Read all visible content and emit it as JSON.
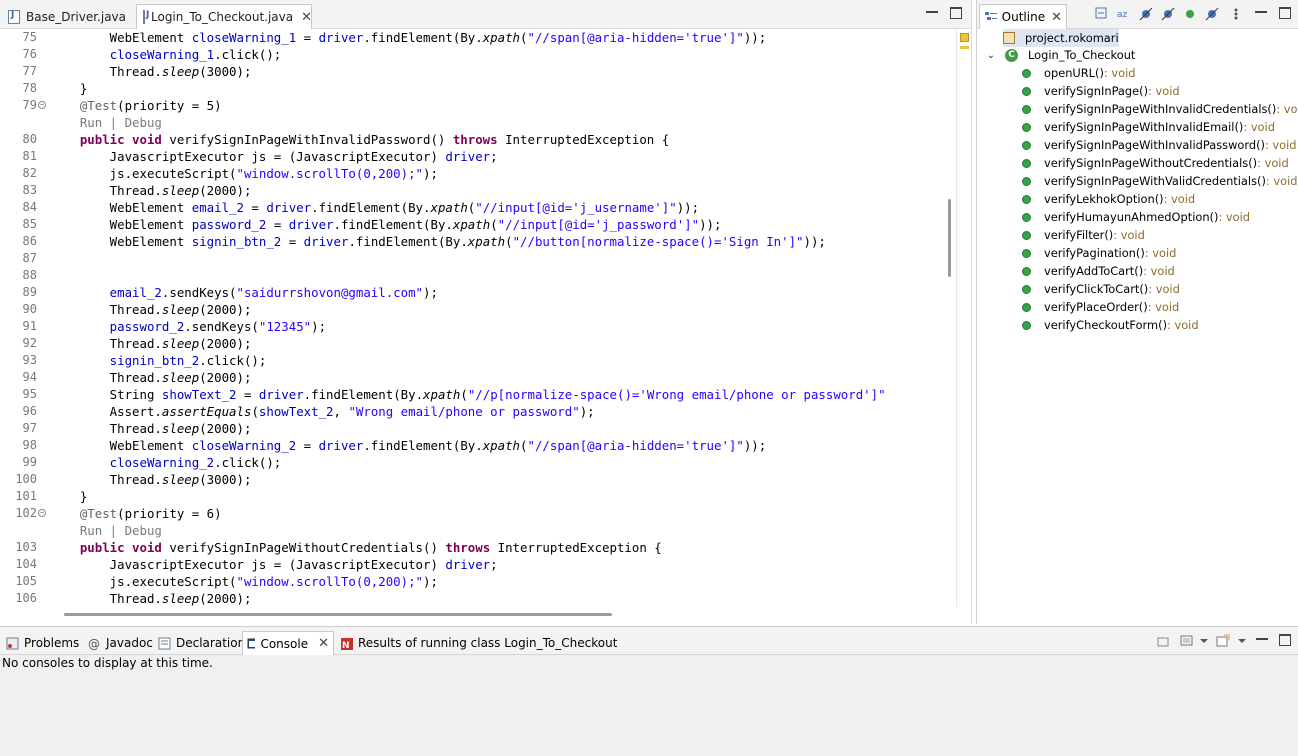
{
  "editor": {
    "tabs": [
      {
        "label": "Base_Driver.java",
        "active": false
      },
      {
        "label": "Login_To_Checkout.java",
        "active": true
      }
    ],
    "close_glyph": "✕",
    "lines": [
      {
        "n": "75",
        "tokens": [
          [
            "",
            "        WebElement "
          ],
          [
            "fld",
            "closeWarning_1"
          ],
          [
            "",
            " = "
          ],
          [
            "fld",
            "driver"
          ],
          [
            "",
            ".findElement(By."
          ],
          [
            "it",
            "xpath"
          ],
          [
            "",
            "("
          ],
          [
            "str",
            "\"//span[@aria-hidden='true']\""
          ],
          [
            "",
            "));"
          ]
        ]
      },
      {
        "n": "76",
        "tokens": [
          [
            "",
            "        "
          ],
          [
            "fld",
            "closeWarning_1"
          ],
          [
            "",
            ".click();"
          ]
        ]
      },
      {
        "n": "77",
        "tokens": [
          [
            "",
            "        Thread."
          ],
          [
            "it",
            "sleep"
          ],
          [
            "",
            "(3000);"
          ]
        ]
      },
      {
        "n": "78",
        "tokens": [
          [
            "",
            "    }"
          ]
        ]
      },
      {
        "n": "79",
        "fold": true,
        "tokens": [
          [
            "ann",
            "    @Test"
          ],
          [
            "",
            "(priority = 5)"
          ]
        ]
      },
      {
        "n": "",
        "tokens": [
          [
            "lnk",
            "    Run | Debug"
          ]
        ]
      },
      {
        "n": "80",
        "tokens": [
          [
            "kw",
            "    public void"
          ],
          [
            "",
            " verifySignInPageWithInvalidPassword() "
          ],
          [
            "kw",
            "throws"
          ],
          [
            "",
            " InterruptedException {"
          ]
        ]
      },
      {
        "n": "81",
        "tokens": [
          [
            "",
            "        JavascriptExecutor js = (JavascriptExecutor) "
          ],
          [
            "fld",
            "driver"
          ],
          [
            "",
            ";"
          ]
        ]
      },
      {
        "n": "82",
        "tokens": [
          [
            "",
            "        js.executeScript("
          ],
          [
            "str",
            "\"window.scrollTo(0,200);\""
          ],
          [
            "",
            ");"
          ]
        ]
      },
      {
        "n": "83",
        "tokens": [
          [
            "",
            "        Thread."
          ],
          [
            "it",
            "sleep"
          ],
          [
            "",
            "(2000);"
          ]
        ]
      },
      {
        "n": "84",
        "tokens": [
          [
            "",
            "        WebElement "
          ],
          [
            "fld",
            "email_2"
          ],
          [
            "",
            " = "
          ],
          [
            "fld",
            "driver"
          ],
          [
            "",
            ".findElement(By."
          ],
          [
            "it",
            "xpath"
          ],
          [
            "",
            "("
          ],
          [
            "str",
            "\"//input[@id='j_username']\""
          ],
          [
            "",
            "));"
          ]
        ]
      },
      {
        "n": "85",
        "tokens": [
          [
            "",
            "        WebElement "
          ],
          [
            "fld",
            "password_2"
          ],
          [
            "",
            " = "
          ],
          [
            "fld",
            "driver"
          ],
          [
            "",
            ".findElement(By."
          ],
          [
            "it",
            "xpath"
          ],
          [
            "",
            "("
          ],
          [
            "str",
            "\"//input[@id='j_password']\""
          ],
          [
            "",
            "));"
          ]
        ]
      },
      {
        "n": "86",
        "tokens": [
          [
            "",
            "        WebElement "
          ],
          [
            "fld",
            "signin_btn_2"
          ],
          [
            "",
            " = "
          ],
          [
            "fld",
            "driver"
          ],
          [
            "",
            ".findElement(By."
          ],
          [
            "it",
            "xpath"
          ],
          [
            "",
            "("
          ],
          [
            "str",
            "\"//button[normalize-space()='Sign In']\""
          ],
          [
            "",
            "));"
          ]
        ]
      },
      {
        "n": "87",
        "tokens": []
      },
      {
        "n": "88",
        "tokens": []
      },
      {
        "n": "89",
        "tokens": [
          [
            "fld",
            "        email_2"
          ],
          [
            "",
            ".sendKeys("
          ],
          [
            "str",
            "\"saidurrshovon@gmail.com\""
          ],
          [
            "",
            ");"
          ]
        ]
      },
      {
        "n": "90",
        "tokens": [
          [
            "",
            "        Thread."
          ],
          [
            "it",
            "sleep"
          ],
          [
            "",
            "(2000);"
          ]
        ]
      },
      {
        "n": "91",
        "tokens": [
          [
            "fld",
            "        password_2"
          ],
          [
            "",
            ".sendKeys("
          ],
          [
            "str",
            "\"12345\""
          ],
          [
            "",
            ");"
          ]
        ]
      },
      {
        "n": "92",
        "tokens": [
          [
            "",
            "        Thread."
          ],
          [
            "it",
            "sleep"
          ],
          [
            "",
            "(2000);"
          ]
        ]
      },
      {
        "n": "93",
        "tokens": [
          [
            "fld",
            "        signin_btn_2"
          ],
          [
            "",
            ".click();"
          ]
        ]
      },
      {
        "n": "94",
        "tokens": [
          [
            "",
            "        Thread."
          ],
          [
            "it",
            "sleep"
          ],
          [
            "",
            "(2000);"
          ]
        ]
      },
      {
        "n": "95",
        "tokens": [
          [
            "",
            "        String "
          ],
          [
            "fld",
            "showText_2"
          ],
          [
            "",
            " = "
          ],
          [
            "fld",
            "driver"
          ],
          [
            "",
            ".findElement(By."
          ],
          [
            "it",
            "xpath"
          ],
          [
            "",
            "("
          ],
          [
            "str",
            "\"//p[normalize-space()='Wrong email/phone or password']\""
          ]
        ]
      },
      {
        "n": "96",
        "tokens": [
          [
            "",
            "        Assert."
          ],
          [
            "it",
            "assertEquals"
          ],
          [
            "",
            "("
          ],
          [
            "fld",
            "showText_2"
          ],
          [
            "",
            ", "
          ],
          [
            "str",
            "\"Wrong email/phone or password\""
          ],
          [
            "",
            ");"
          ]
        ]
      },
      {
        "n": "97",
        "tokens": [
          [
            "",
            "        Thread."
          ],
          [
            "it",
            "sleep"
          ],
          [
            "",
            "(2000);"
          ]
        ]
      },
      {
        "n": "98",
        "tokens": [
          [
            "",
            "        WebElement "
          ],
          [
            "fld",
            "closeWarning_2"
          ],
          [
            "",
            " = "
          ],
          [
            "fld",
            "driver"
          ],
          [
            "",
            ".findElement(By."
          ],
          [
            "it",
            "xpath"
          ],
          [
            "",
            "("
          ],
          [
            "str",
            "\"//span[@aria-hidden='true']\""
          ],
          [
            "",
            "));"
          ]
        ]
      },
      {
        "n": "99",
        "tokens": [
          [
            "fld",
            "        closeWarning_2"
          ],
          [
            "",
            ".click();"
          ]
        ]
      },
      {
        "n": "100",
        "tokens": [
          [
            "",
            "        Thread."
          ],
          [
            "it",
            "sleep"
          ],
          [
            "",
            "(3000);"
          ]
        ]
      },
      {
        "n": "101",
        "tokens": [
          [
            "",
            "    }"
          ]
        ]
      },
      {
        "n": "102",
        "fold": true,
        "tokens": [
          [
            "ann",
            "    @Test"
          ],
          [
            "",
            "(priority = 6)"
          ]
        ]
      },
      {
        "n": "",
        "tokens": [
          [
            "lnk",
            "    Run | Debug"
          ]
        ]
      },
      {
        "n": "103",
        "tokens": [
          [
            "kw",
            "    public void"
          ],
          [
            "",
            " verifySignInPageWithoutCredentials() "
          ],
          [
            "kw",
            "throws"
          ],
          [
            "",
            " InterruptedException {"
          ]
        ]
      },
      {
        "n": "104",
        "tokens": [
          [
            "",
            "        JavascriptExecutor js = (JavascriptExecutor) "
          ],
          [
            "fld",
            "driver"
          ],
          [
            "",
            ";"
          ]
        ]
      },
      {
        "n": "105",
        "tokens": [
          [
            "",
            "        js.executeScript("
          ],
          [
            "str",
            "\"window.scrollTo(0,200);\""
          ],
          [
            "",
            ");"
          ]
        ]
      },
      {
        "n": "106",
        "tokens": [
          [
            "",
            "        Thread."
          ],
          [
            "it",
            "sleep"
          ],
          [
            "",
            "(2000);"
          ]
        ]
      }
    ]
  },
  "outline": {
    "title": "Outline",
    "package": "project.rokomari",
    "class_name": "Login_To_Checkout",
    "methods": [
      {
        "name": "openURL()",
        "ret": " : void"
      },
      {
        "name": "verifySignInPage()",
        "ret": " : void"
      },
      {
        "name": "verifySignInPageWithInvalidCredentials()",
        "ret": " : void"
      },
      {
        "name": "verifySignInPageWithInvalidEmail()",
        "ret": " : void"
      },
      {
        "name": "verifySignInPageWithInvalidPassword()",
        "ret": " : void"
      },
      {
        "name": "verifySignInPageWithoutCredentials()",
        "ret": " : void"
      },
      {
        "name": "verifySignInPageWithValidCredentials()",
        "ret": " : void"
      },
      {
        "name": "verifyLekhokOption()",
        "ret": " : void"
      },
      {
        "name": "verifyHumayunAhmedOption()",
        "ret": " : void"
      },
      {
        "name": "verifyFilter()",
        "ret": " : void"
      },
      {
        "name": "verifyPagination()",
        "ret": " : void"
      },
      {
        "name": "verifyAddToCart()",
        "ret": " : void"
      },
      {
        "name": "verifyClickToCart()",
        "ret": " : void"
      },
      {
        "name": "verifyPlaceOrder()",
        "ret": " : void"
      },
      {
        "name": "verifyCheckoutForm()",
        "ret": " : void"
      }
    ]
  },
  "bottom": {
    "tabs": [
      {
        "label": "Problems",
        "icon": "problems-icon"
      },
      {
        "label": "Javadoc",
        "icon": "javadoc-icon"
      },
      {
        "label": "Declaration",
        "icon": "declaration-icon"
      },
      {
        "label": "Console",
        "icon": "console-icon",
        "active": true
      },
      {
        "label": "Results of running class Login_To_Checkout",
        "icon": "testng-icon"
      }
    ],
    "console_message": "No consoles to display at this time."
  },
  "colors": {
    "keyword": "#7f0055",
    "string": "#2a00ff",
    "field": "#0000c0",
    "method_dot": "#3aa24a"
  }
}
